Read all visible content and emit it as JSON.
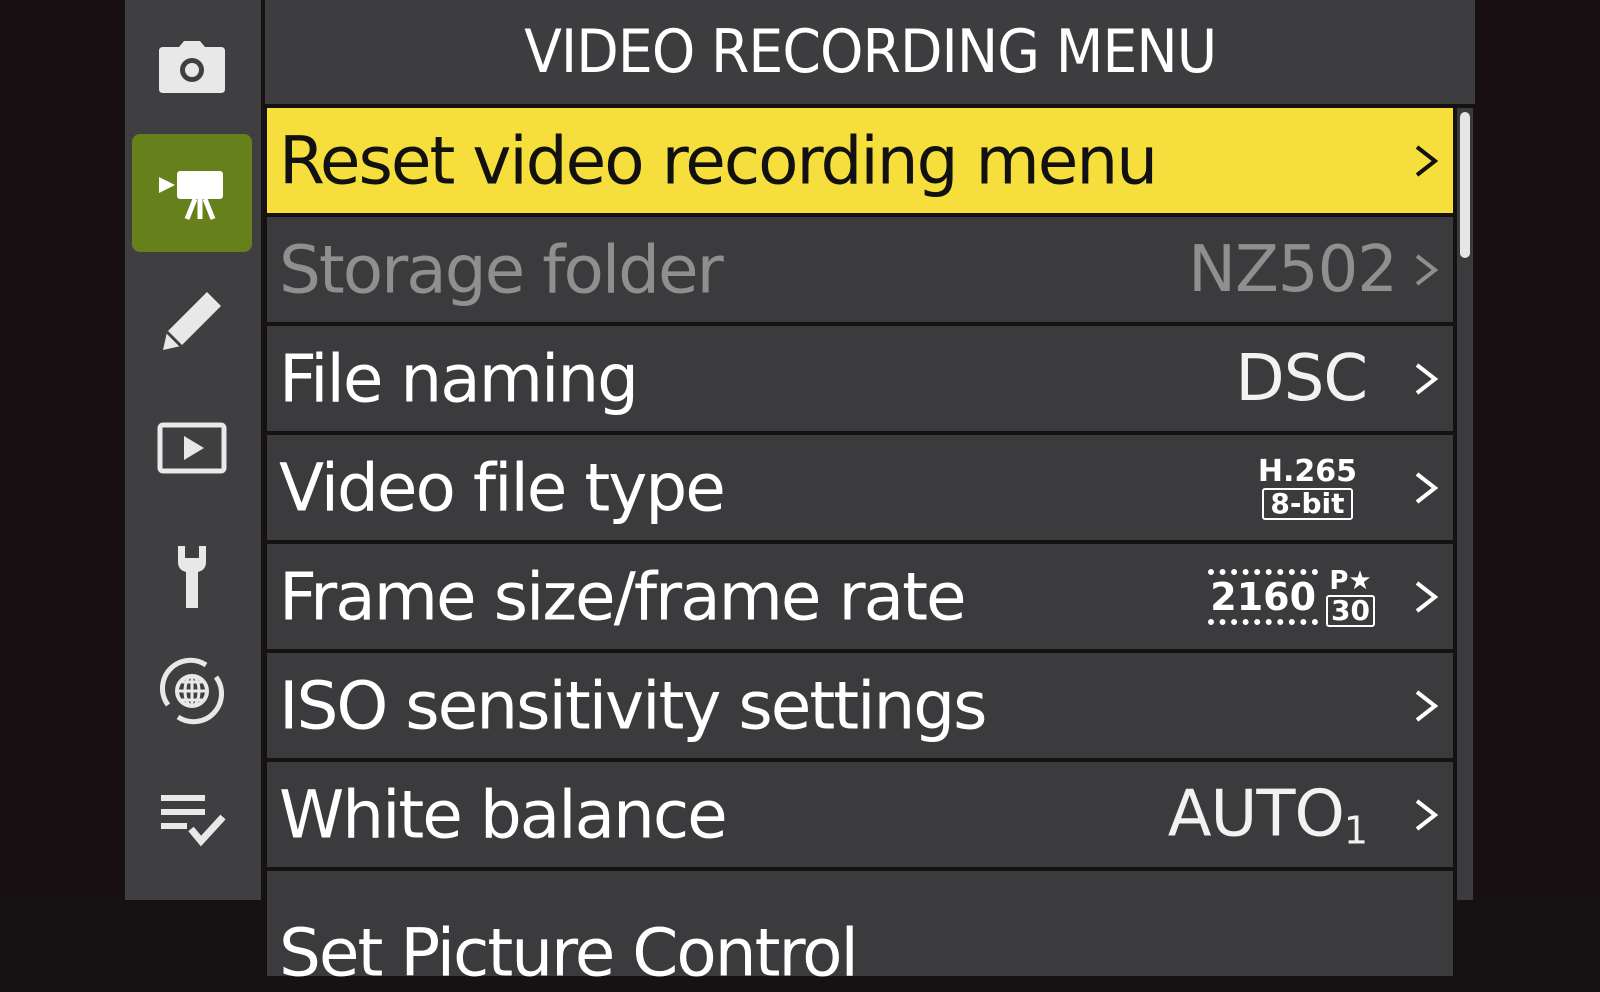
{
  "header": {
    "title": "VIDEO RECORDING MENU"
  },
  "sidebar": {
    "items": [
      {
        "icon": "camera-icon",
        "active": false
      },
      {
        "icon": "video-camera-icon",
        "active": true
      },
      {
        "icon": "pencil-icon",
        "active": false
      },
      {
        "icon": "playback-icon",
        "active": false
      },
      {
        "icon": "wrench-icon",
        "active": false
      },
      {
        "icon": "network-globe-icon",
        "active": false
      },
      {
        "icon": "checklist-icon",
        "active": false
      }
    ],
    "active_color": "#66801c"
  },
  "menu": {
    "items": [
      {
        "label": "Reset video recording menu",
        "value": "",
        "selected": true
      },
      {
        "label": "Storage folder",
        "value": "NZ502",
        "disabled": true
      },
      {
        "label": "File naming",
        "value": "DSC"
      },
      {
        "label": "Video file type",
        "value_top": "H.265",
        "value_bottom": "8-bit"
      },
      {
        "label": "Frame size/frame rate",
        "frame_size": "2160",
        "frame_rate_top": "P★",
        "frame_rate": "30"
      },
      {
        "label": "ISO sensitivity settings",
        "value": ""
      },
      {
        "label": "White balance",
        "value": "AUTO",
        "value_sub": "1"
      },
      {
        "label": "Set Picture Control",
        "value": ""
      }
    ],
    "highlight_color": "#f6de3c"
  }
}
